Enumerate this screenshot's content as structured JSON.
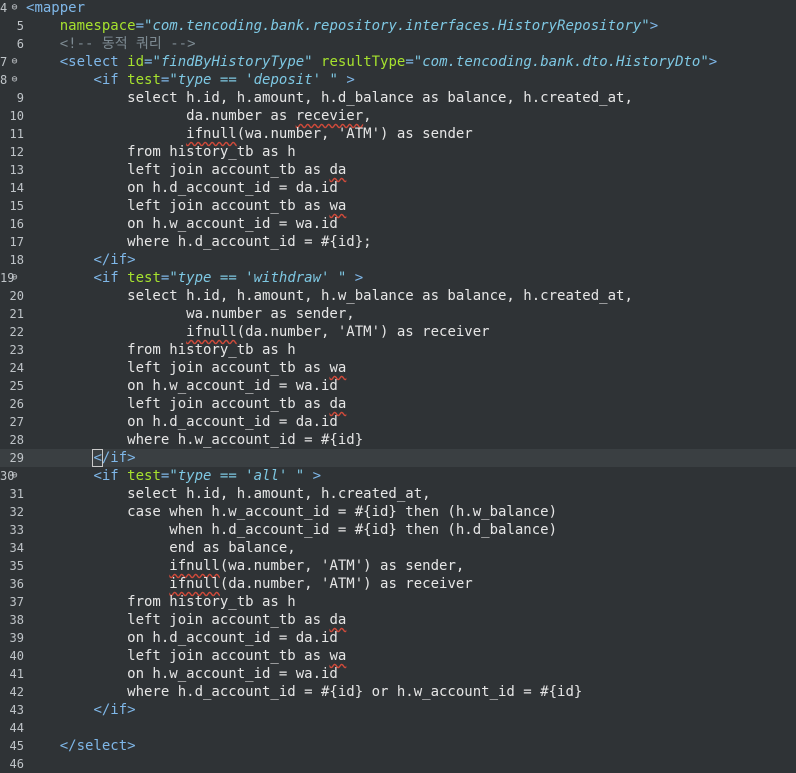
{
  "lines": [
    {
      "num": "4",
      "fold": true,
      "spans": [
        {
          "t": "<",
          "c": "tag"
        },
        {
          "t": "mapper",
          "c": "tag"
        }
      ]
    },
    {
      "num": "5",
      "spans": [
        {
          "t": "    "
        },
        {
          "t": "namespace",
          "c": "attr"
        },
        {
          "t": "=",
          "c": "tag"
        },
        {
          "t": "\"com.tencoding.bank.repository.interfaces.HistoryRepository\"",
          "c": "str"
        },
        {
          "t": ">",
          "c": "tag"
        }
      ]
    },
    {
      "num": "6",
      "spans": [
        {
          "t": "    "
        },
        {
          "t": "<!-- 동적 쿼리 -->",
          "c": "cmt"
        }
      ]
    },
    {
      "num": "7",
      "fold": true,
      "spans": [
        {
          "t": "    "
        },
        {
          "t": "<select ",
          "c": "tag"
        },
        {
          "t": "id",
          "c": "attr"
        },
        {
          "t": "=",
          "c": "tag"
        },
        {
          "t": "\"findByHistoryType\"",
          "c": "str"
        },
        {
          "t": " "
        },
        {
          "t": "resultType",
          "c": "attr"
        },
        {
          "t": "=",
          "c": "tag"
        },
        {
          "t": "\"com.tencoding.bank.dto.HistoryDto\"",
          "c": "str"
        },
        {
          "t": ">",
          "c": "tag"
        }
      ]
    },
    {
      "num": "8",
      "fold": true,
      "spans": [
        {
          "t": "        "
        },
        {
          "t": "<if ",
          "c": "tag"
        },
        {
          "t": "test",
          "c": "attr"
        },
        {
          "t": "=",
          "c": "tag"
        },
        {
          "t": "\"type == 'deposit' \"",
          "c": "str"
        },
        {
          "t": " >",
          "c": "tag"
        }
      ]
    },
    {
      "num": "9",
      "spans": [
        {
          "t": "            select h.id, h.amount, h.d_balance as balance, h.created_at,",
          "c": "sql"
        }
      ]
    },
    {
      "num": "10",
      "spans": [
        {
          "t": "                   da.number as ",
          "c": "sql"
        },
        {
          "t": "recevier",
          "c": "sql",
          "w": true
        },
        {
          "t": ",",
          "c": "sql"
        }
      ]
    },
    {
      "num": "11",
      "spans": [
        {
          "t": "                   ",
          "c": "sql"
        },
        {
          "t": "ifnull",
          "c": "sql",
          "w": true
        },
        {
          "t": "(wa.number, 'ATM') as sender",
          "c": "sql"
        }
      ]
    },
    {
      "num": "12",
      "spans": [
        {
          "t": "            from history_tb as h",
          "c": "sql"
        }
      ]
    },
    {
      "num": "13",
      "spans": [
        {
          "t": "            left join account_tb as ",
          "c": "sql"
        },
        {
          "t": "da",
          "c": "sql",
          "w": true
        }
      ]
    },
    {
      "num": "14",
      "spans": [
        {
          "t": "            on h.d_account_id = da.id",
          "c": "sql"
        }
      ]
    },
    {
      "num": "15",
      "spans": [
        {
          "t": "            left join account_tb as ",
          "c": "sql"
        },
        {
          "t": "wa",
          "c": "sql",
          "w": true
        }
      ]
    },
    {
      "num": "16",
      "spans": [
        {
          "t": "            on h.w_account_id = wa.id",
          "c": "sql"
        }
      ]
    },
    {
      "num": "17",
      "spans": [
        {
          "t": "            where h.d_account_id = #{id};",
          "c": "sql"
        }
      ]
    },
    {
      "num": "18",
      "spans": [
        {
          "t": "        "
        },
        {
          "t": "</if>",
          "c": "tag"
        }
      ]
    },
    {
      "num": "19",
      "fold": true,
      "spans": [
        {
          "t": "        "
        },
        {
          "t": "<if ",
          "c": "tag"
        },
        {
          "t": "test",
          "c": "attr"
        },
        {
          "t": "=",
          "c": "tag"
        },
        {
          "t": "\"type == 'withdraw' \"",
          "c": "str"
        },
        {
          "t": " >",
          "c": "tag"
        }
      ]
    },
    {
      "num": "20",
      "spans": [
        {
          "t": "            select h.id, h.amount, h.w_balance as balance, h.created_at,",
          "c": "sql"
        }
      ]
    },
    {
      "num": "21",
      "spans": [
        {
          "t": "                   wa.number as sender,",
          "c": "sql"
        }
      ]
    },
    {
      "num": "22",
      "spans": [
        {
          "t": "                   ",
          "c": "sql"
        },
        {
          "t": "ifnull",
          "c": "sql",
          "w": true
        },
        {
          "t": "(da.number, 'ATM') as receiver",
          "c": "sql"
        }
      ]
    },
    {
      "num": "23",
      "spans": [
        {
          "t": "            from history_tb as h",
          "c": "sql"
        }
      ]
    },
    {
      "num": "24",
      "spans": [
        {
          "t": "            left join account_tb as ",
          "c": "sql"
        },
        {
          "t": "wa",
          "c": "sql",
          "w": true
        }
      ]
    },
    {
      "num": "25",
      "spans": [
        {
          "t": "            on h.w_account_id = wa.id",
          "c": "sql"
        }
      ]
    },
    {
      "num": "26",
      "spans": [
        {
          "t": "            left join account_tb as ",
          "c": "sql"
        },
        {
          "t": "da",
          "c": "sql",
          "w": true
        }
      ]
    },
    {
      "num": "27",
      "spans": [
        {
          "t": "            on h.d_account_id = da.id",
          "c": "sql"
        }
      ]
    },
    {
      "num": "28",
      "spans": [
        {
          "t": "            where h.w_account_id = #{id}",
          "c": "sql"
        }
      ]
    },
    {
      "num": "29",
      "current": true,
      "spans": [
        {
          "t": "        "
        },
        {
          "t": "<",
          "c": "tag",
          "caret": true
        },
        {
          "t": "/if>",
          "c": "tag"
        }
      ]
    },
    {
      "num": "30",
      "fold": true,
      "spans": [
        {
          "t": "        "
        },
        {
          "t": "<if ",
          "c": "tag"
        },
        {
          "t": "test",
          "c": "attr"
        },
        {
          "t": "=",
          "c": "tag"
        },
        {
          "t": "\"type == 'all' \"",
          "c": "str"
        },
        {
          "t": " >",
          "c": "tag"
        }
      ]
    },
    {
      "num": "31",
      "spans": [
        {
          "t": "            select h.id, h.amount, h.created_at,",
          "c": "sql"
        }
      ]
    },
    {
      "num": "32",
      "spans": [
        {
          "t": "            case when h.w_account_id = #{id} then (h.w_balance)",
          "c": "sql"
        }
      ]
    },
    {
      "num": "33",
      "spans": [
        {
          "t": "                 when h.d_account_id = #{id} then (h.d_balance)",
          "c": "sql"
        }
      ]
    },
    {
      "num": "34",
      "spans": [
        {
          "t": "                 end as balance,",
          "c": "sql"
        }
      ]
    },
    {
      "num": "35",
      "spans": [
        {
          "t": "                 ",
          "c": "sql"
        },
        {
          "t": "ifnull",
          "c": "sql",
          "w": true
        },
        {
          "t": "(wa.number, 'ATM') as sender,",
          "c": "sql"
        }
      ]
    },
    {
      "num": "36",
      "spans": [
        {
          "t": "                 ",
          "c": "sql"
        },
        {
          "t": "ifnull",
          "c": "sql",
          "w": true
        },
        {
          "t": "(da.number, 'ATM') as receiver",
          "c": "sql"
        }
      ]
    },
    {
      "num": "37",
      "spans": [
        {
          "t": "            from history_tb as h",
          "c": "sql"
        }
      ]
    },
    {
      "num": "38",
      "spans": [
        {
          "t": "            left join account_tb as ",
          "c": "sql"
        },
        {
          "t": "da",
          "c": "sql",
          "w": true
        }
      ]
    },
    {
      "num": "39",
      "spans": [
        {
          "t": "            on h.d_account_id = da.id",
          "c": "sql"
        }
      ]
    },
    {
      "num": "40",
      "spans": [
        {
          "t": "            left join account_tb as ",
          "c": "sql"
        },
        {
          "t": "wa",
          "c": "sql",
          "w": true
        }
      ]
    },
    {
      "num": "41",
      "spans": [
        {
          "t": "            on h.w_account_id = wa.id",
          "c": "sql"
        }
      ]
    },
    {
      "num": "42",
      "spans": [
        {
          "t": "            where h.d_account_id = #{id} or h.w_account_id = #{id}",
          "c": "sql"
        }
      ]
    },
    {
      "num": "43",
      "spans": [
        {
          "t": "        "
        },
        {
          "t": "</if>",
          "c": "tag"
        }
      ]
    },
    {
      "num": "44",
      "spans": []
    },
    {
      "num": "45",
      "spans": [
        {
          "t": "    "
        },
        {
          "t": "</select>",
          "c": "tag"
        }
      ]
    },
    {
      "num": "46",
      "spans": []
    }
  ],
  "icons": {
    "fold": "fold-collapse-icon",
    "warning": "spelling-warning-underline"
  },
  "colors": {
    "background": "#2f3336",
    "current_line": "#3a3f42",
    "tag": "#7fb7e8",
    "attribute": "#a6e22e",
    "string": "#7ec8e3",
    "comment": "#7d8a92",
    "warning": "#d04a3a"
  }
}
